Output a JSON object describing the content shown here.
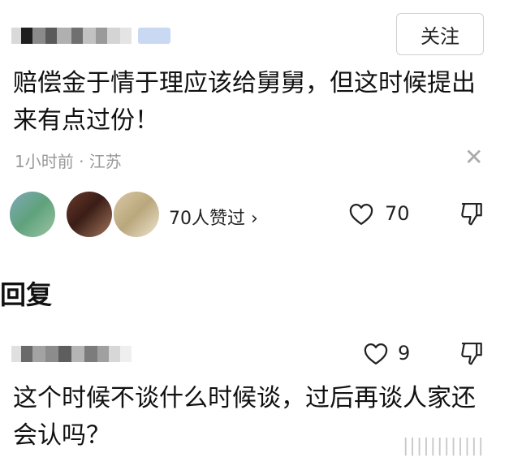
{
  "comment": {
    "follow_label": "关注",
    "text": "赔偿金于情于理应该给舅舅，但这时候提出来有点过份！",
    "meta": "1小时前 · 江苏",
    "likers_text": "70人赞过 ›",
    "like_count": "70"
  },
  "section_title": "回复",
  "reply": {
    "like_count": "9",
    "text": "这个时候不谈什么时候谈，过后再谈人家还会认吗？"
  },
  "watermark": "||||||||||||",
  "icons": {
    "close": "close-icon",
    "like": "heart-outline-icon",
    "dislike": "thumbs-down-icon"
  }
}
